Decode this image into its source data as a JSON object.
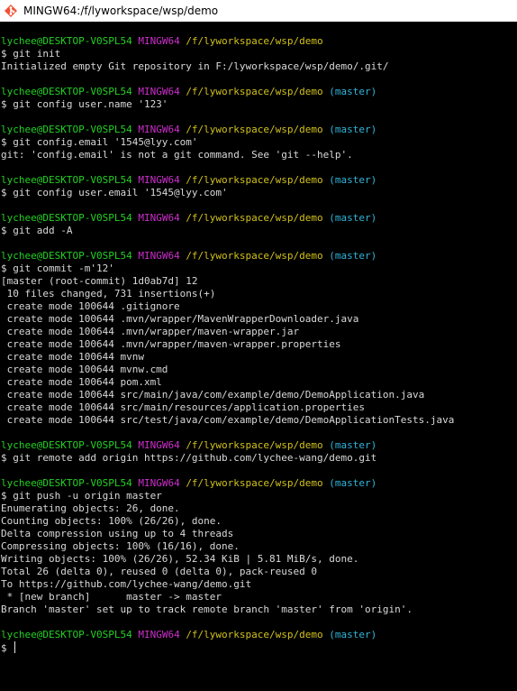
{
  "window": {
    "title": "MINGW64:/f/lyworkspace/wsp/demo"
  },
  "colors": {
    "background": "#000000",
    "text": "#d9d9d9",
    "user": "#23d023",
    "system": "#cc2fcc",
    "path": "#d2c21c",
    "branch": "#2fb5d9"
  },
  "prompt": {
    "user": "lychee@DESKTOP-V0SPL54",
    "system": "MINGW64",
    "path": "/f/lyworkspace/wsp/demo",
    "branch": "(master)",
    "symbol": "$"
  },
  "blocks": [
    {
      "show_branch": false,
      "command": "$ git init",
      "output": [
        "Initialized empty Git repository in F:/lyworkspace/wsp/demo/.git/"
      ]
    },
    {
      "show_branch": true,
      "command": "$ git config user.name '123'",
      "output": []
    },
    {
      "show_branch": true,
      "command": "$ git config.email '1545@lyy.com'",
      "output": [
        "git: 'config.email' is not a git command. See 'git --help'."
      ]
    },
    {
      "show_branch": true,
      "command": "$ git config user.email '1545@lyy.com'",
      "output": []
    },
    {
      "show_branch": true,
      "command": "$ git add -A",
      "output": []
    },
    {
      "show_branch": true,
      "command": "$ git commit -m'12'",
      "output": [
        "[master (root-commit) 1d0ab7d] 12",
        " 10 files changed, 731 insertions(+)",
        " create mode 100644 .gitignore",
        " create mode 100644 .mvn/wrapper/MavenWrapperDownloader.java",
        " create mode 100644 .mvn/wrapper/maven-wrapper.jar",
        " create mode 100644 .mvn/wrapper/maven-wrapper.properties",
        " create mode 100644 mvnw",
        " create mode 100644 mvnw.cmd",
        " create mode 100644 pom.xml",
        " create mode 100644 src/main/java/com/example/demo/DemoApplication.java",
        " create mode 100644 src/main/resources/application.properties",
        " create mode 100644 src/test/java/com/example/demo/DemoApplicationTests.java"
      ]
    },
    {
      "show_branch": true,
      "command": "$ git remote add origin https://github.com/lychee-wang/demo.git",
      "output": []
    },
    {
      "show_branch": true,
      "command": "$ git push -u origin master",
      "output": [
        "Enumerating objects: 26, done.",
        "Counting objects: 100% (26/26), done.",
        "Delta compression using up to 4 threads",
        "Compressing objects: 100% (16/16), done.",
        "Writing objects: 100% (26/26), 52.34 KiB | 5.81 MiB/s, done.",
        "Total 26 (delta 0), reused 0 (delta 0), pack-reused 0",
        "To https://github.com/lychee-wang/demo.git",
        " * [new branch]      master -> master",
        "Branch 'master' set up to track remote branch 'master' from 'origin'."
      ]
    }
  ],
  "final_prompt": {
    "show_branch": true,
    "input": "$ "
  }
}
